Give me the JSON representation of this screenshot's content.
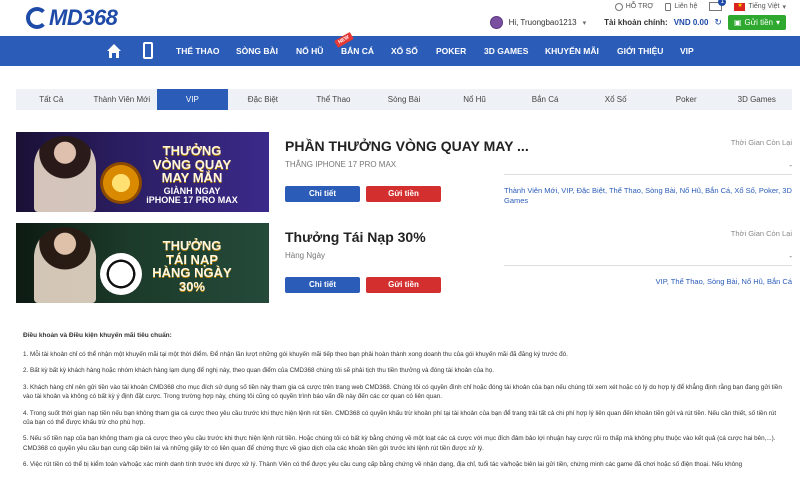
{
  "header": {
    "logo_text": "MD368",
    "links": {
      "support": "HỖ TRỢ",
      "contact": "Liên hệ",
      "mail_count": "1",
      "language": "Tiếng Việt"
    },
    "greeting": "Hi, Truongbao1213",
    "account_label": "Tài khoản chính:",
    "balance": "VND 0.00",
    "deposit": "Gửi tiền"
  },
  "nav": {
    "items": [
      "THỂ THAO",
      "SÒNG BÀI",
      "NỔ HŨ",
      "BẮN CÁ",
      "XỔ SỐ",
      "POKER",
      "3D GAMES",
      "KHUYẾN MÃI",
      "GIỚI THIỆU",
      "VIP"
    ],
    "new_badge": "NEW"
  },
  "tabs": [
    "Tất Cả",
    "Thành Viên Mới",
    "VIP",
    "Đặc Biệt",
    "Thể Thao",
    "Sòng Bài",
    "Nổ Hũ",
    "Bắn Cá",
    "Xổ Số",
    "Poker",
    "3D Games"
  ],
  "promos": [
    {
      "banner": {
        "line1": "THƯỞNG",
        "line2": "VÒNG QUAY",
        "line3": "MAY MẮN",
        "line4": "GIÀNH NGAY",
        "line5": "iPHONE 17 PRO MAX"
      },
      "title": "PHẦN THƯỞNG VÒNG QUAY MAY ...",
      "subtitle": "THẮNG IPHONE 17 PRO MAX",
      "detail": "Chi tiết",
      "deposit": "Gửi tiền",
      "time_label": "Thời Gian Còn Lại",
      "time_value": "-",
      "categories": "Thành Viên Mới, VIP, Đặc Biệt, Thể Thao, Sòng Bài, Nổ Hũ, Bắn Cá, Xổ Số, Poker, 3D Games"
    },
    {
      "banner": {
        "line1": "THƯỞNG",
        "line2": "TÁI NẠP",
        "line3": "HÀNG NGÀY",
        "line4": "30%"
      },
      "title": "Thưởng Tái Nạp 30%",
      "subtitle": "Hàng Ngày",
      "detail": "Chi tiết",
      "deposit": "Gửi tiền",
      "time_label": "Thời Gian Còn Lại",
      "time_value": "-",
      "categories": "VIP, Thể Thao, Sòng Bài, Nổ Hũ, Bắn Cá"
    }
  ],
  "terms": {
    "title": "Điều khoản và Điều kiện khuyến mãi tiêu chuẩn:",
    "items": [
      "1. Mỗi tài khoản chỉ có thể nhận một khuyến mãi tại một thời điểm. Để nhận lần lượt những gói khuyến mãi tiếp theo bạn phải hoàn thành xong doanh thu của gói khuyến mãi đã đăng ký trước đó.",
      "2. Bất kỳ bất kỳ khách hàng hoặc nhóm khách hàng lạm dụng để nghị này, theo quan điểm của CMD368 chúng tôi sẽ phải tịch thu tiền thưởng và đóng tài khoản của họ.",
      "3. Khách hàng chỉ nên gửi tiền vào tài khoản CMD368 cho mục đích sử dụng số tiền này tham gia cá cược trên trang web CMD368. Chúng tôi có quyền đình chỉ hoặc đóng tài khoản của bạn nếu chúng tôi xem xét hoặc có lý do hợp lý để khẳng định rằng bạn đang gửi tiền vào tài khoản và không có bất kỳ ý định đặt cược. Trong trường hợp này, chúng tôi cũng có quyền trình báo vấn đề này đến các cơ quan có liên quan.",
      "4. Trong suốt thời gian nạp tiền nếu bạn không tham gia cá cược theo yêu cầu trước khi thực hiện lệnh rút tiền. CMD368 có quyền khấu trừ khoản phí tại tài khoản của bạn để trang trải tất cả chi phí hợp lý liên quan đến khoản tiền gửi và rút tiền. Nếu cần thiết, số tiền rút của bạn có thể được khấu trừ cho phù hợp.",
      "5. Nếu số tiền nạp của bạn không tham gia cá cược theo yêu cầu trước khi thực hiện lệnh rút tiền. Hoặc chúng tôi có bất kỳ bằng chứng về một loạt các cá cược với mục đích đảm bảo lợi nhuận hay cược rủi ro thấp mà không phụ thuộc vào kết quả (cá cược hai bên,...). CMD368 có quyền yêu cầu bạn cung cấp biên lai và những giấy tờ có liên quan để chứng thực về giao dịch của các khoản tiền gửi trước khi lệnh rút tiền được xử lý.",
      "6. Việc rút tiền có thể bị kiểm toán và/hoặc xác minh danh tính trước khi được xử lý. Thành Viên có thể được yêu cầu cung cấp bằng chứng về nhận dạng, địa chỉ, tuổi tác và/hoặc biên lai gửi tiền, chứng minh các game đã chơi hoặc số điện thoại. Nếu không"
    ]
  },
  "colors": {
    "brand_blue": "#2b5cb8",
    "deposit_red": "#d32f2f",
    "deposit_green": "#2ea82e"
  }
}
